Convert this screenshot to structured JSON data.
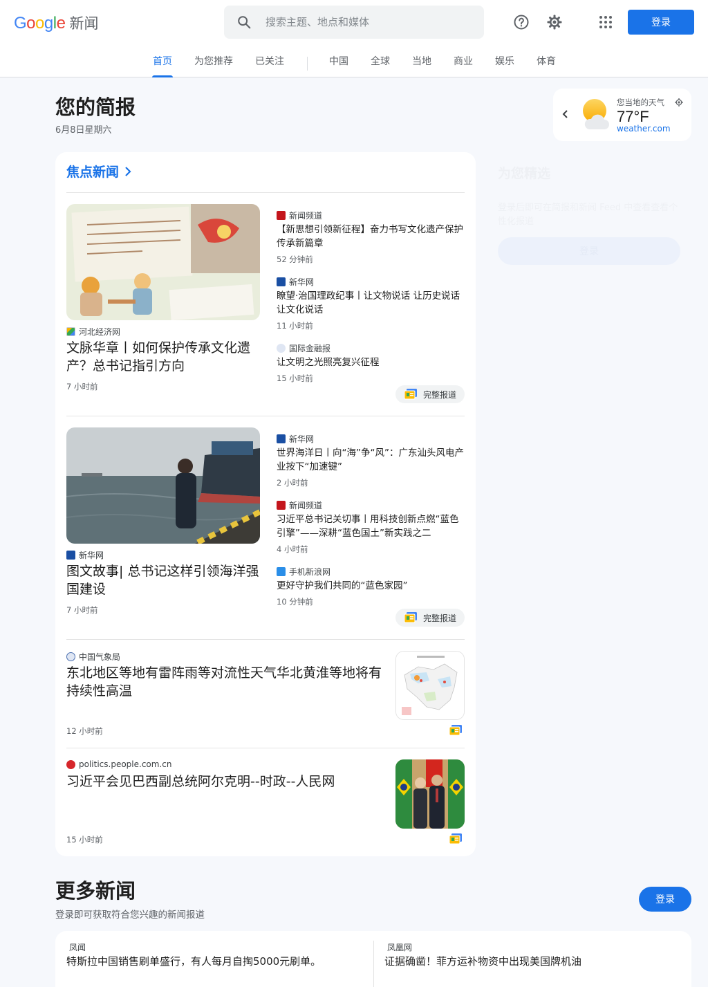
{
  "header": {
    "logo_text": "Google",
    "logo_suffix": "新闻",
    "search_placeholder": "搜索主题、地点和媒体",
    "help_icon": "help-icon",
    "settings_icon": "gear-icon",
    "apps_icon": "apps-grid-icon",
    "signin_label": "登录",
    "accent_color": "#1a73e8"
  },
  "tabs": [
    {
      "label": "首页",
      "active": true
    },
    {
      "label": "为您推荐"
    },
    {
      "label": "已关注"
    },
    {
      "label": "中国"
    },
    {
      "label": "全球"
    },
    {
      "label": "当地"
    },
    {
      "label": "商业"
    },
    {
      "label": "娱乐"
    },
    {
      "label": "体育"
    }
  ],
  "briefing": {
    "title": "您的简报",
    "date": "6月8日星期六"
  },
  "weather": {
    "label": "您当地的天气",
    "temp": "77°F",
    "source": "weather.com"
  },
  "foryou": {
    "title": "为您精选",
    "text": "登录后即可在简报和新闻 Feed 中查看查看个性化报道",
    "button": "登录"
  },
  "top_stories": {
    "heading": "焦点新闻",
    "coverage_label": "完整报道",
    "clusters": [
      {
        "main": {
          "source": "河北经济网",
          "title": "文脉华章丨如何保护传承文化遗产？总书记指引方向",
          "time": "7 小时前"
        },
        "related": [
          {
            "source": "新闻频道",
            "title": "【新思想引领新征程】奋力书写文化遗产保护传承新篇章",
            "time": "52 分钟前"
          },
          {
            "source": "新华网",
            "title": "瞭望·治国理政纪事丨让文物说话 让历史说话 让文化说话",
            "time": "11 小时前"
          },
          {
            "source": "国际金融报",
            "title": "让文明之光照亮复兴征程",
            "time": "15 小时前"
          }
        ]
      },
      {
        "main": {
          "source": "新华网",
          "title": "图文故事| 总书记这样引领海洋强国建设",
          "time": "7 小时前"
        },
        "related": [
          {
            "source": "新华网",
            "title": "世界海洋日丨向“海”争“风”：广东汕头风电产业按下“加速键”",
            "time": "2 小时前"
          },
          {
            "source": "新闻频道",
            "title": "习近平总书记关切事丨用科技创新点燃“蓝色引擎”——深耕“蓝色国土”新实践之二",
            "time": "4 小时前"
          },
          {
            "source": "手机新浪网",
            "title": "更好守护我们共同的“蓝色家园”",
            "time": "10 分钟前"
          }
        ]
      }
    ],
    "singles": [
      {
        "source": "中国气象局",
        "title": "东北地区等地有雷阵雨等对流性天气华北黄淮等地将有持续性高温",
        "time": "12 小时前"
      },
      {
        "source": "politics.people.com.cn",
        "title": "习近平会见巴西副总统阿尔克明--时政--人民网",
        "time": "15 小时前"
      }
    ]
  },
  "more_news": {
    "title": "更多新闻",
    "subtitle": "登录即可获取符合您兴趣的新闻报道",
    "signin_label": "登录",
    "items": [
      {
        "source": "凤闻",
        "title": "特斯拉中国销售刷单盛行，有人每月自掏5000元刷单。"
      },
      {
        "source": "凤凰网",
        "title": "证据确凿！菲方运补物资中出现美国牌机油"
      }
    ]
  }
}
